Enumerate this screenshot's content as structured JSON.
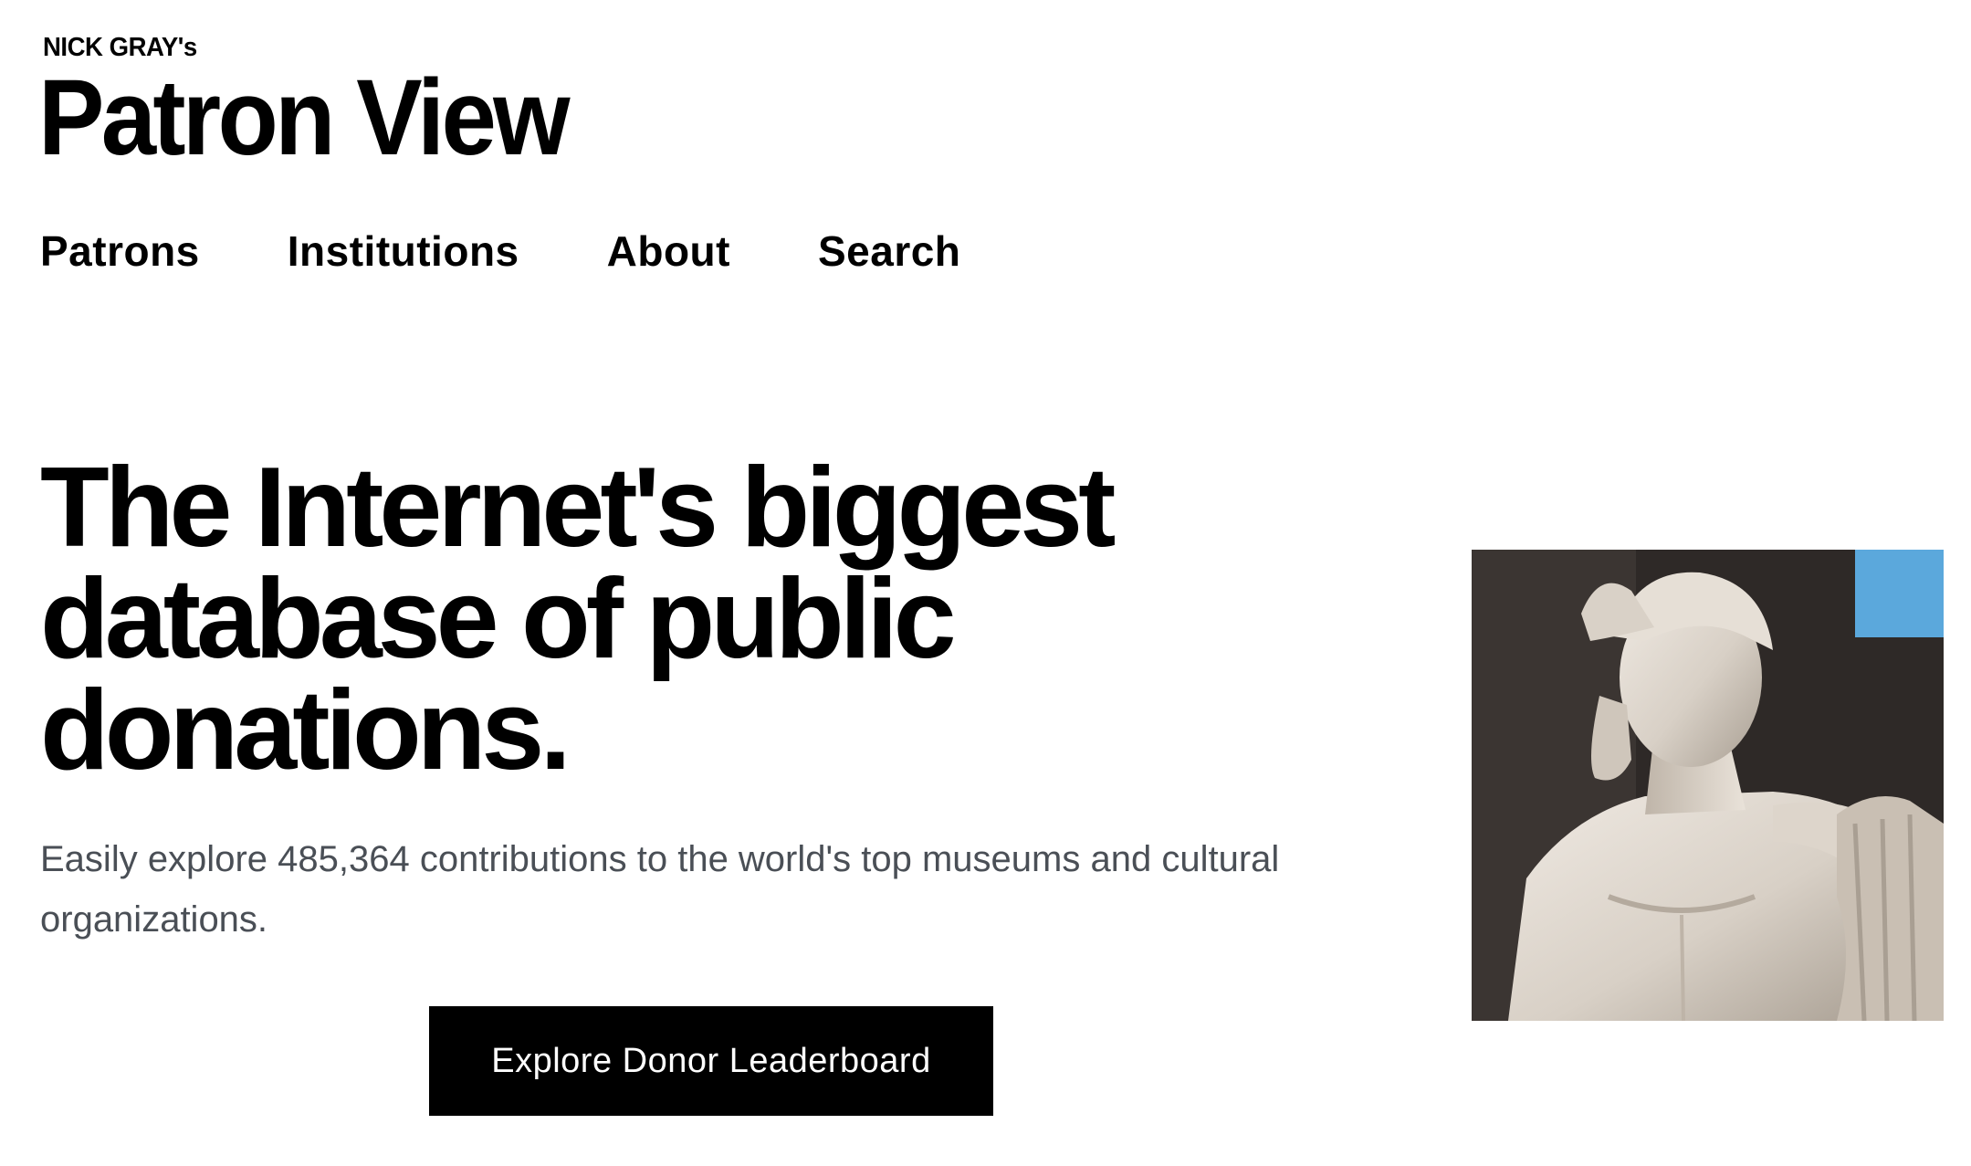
{
  "header": {
    "kicker": "NICK GRAY's",
    "title": "Patron View"
  },
  "nav": {
    "items": [
      {
        "label": "Patrons"
      },
      {
        "label": "Institutions"
      },
      {
        "label": "About"
      },
      {
        "label": "Search"
      }
    ]
  },
  "hero": {
    "heading_line1": "The Internet's biggest",
    "heading_line2": "database of public",
    "heading_line3": "donations.",
    "subtitle": "Easily explore 485,364 contributions to the world's top museums and cultural organizations.",
    "cta_label": "Explore Donor Leaderboard",
    "image_icon": "marble-statue-image",
    "accent_color": "#5ba8dc"
  }
}
